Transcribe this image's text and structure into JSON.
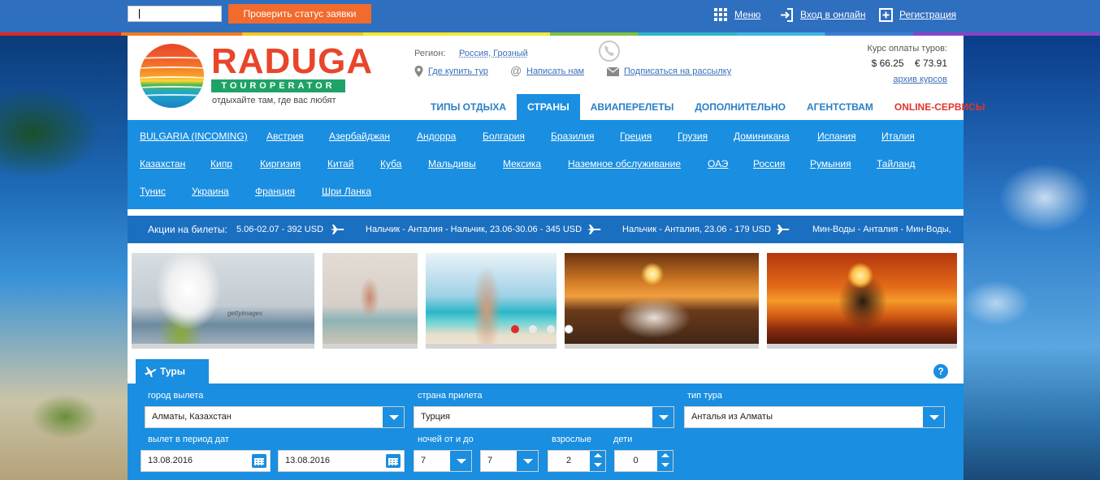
{
  "topbar": {
    "status_button": "Проверить статус заявки",
    "menu_label": "Меню",
    "login_label": "Вход в онлайн",
    "register_label": "Регистрация"
  },
  "header": {
    "logo_title": "RADUGA",
    "logo_sub": "TOUROPERATOR",
    "slogan": "отдыхайте там, где вас любят",
    "region_label": "Регион:",
    "region_value": "Россия, Грозный",
    "where_buy": "Где купить тур",
    "write_us": "Написать нам",
    "subscribe": "Подписаться на рассылку",
    "rate_label": "Курс оплаты туров:",
    "usd_rate": "$ 66.25",
    "eur_rate": "€ 73.91",
    "archive": "архив курсов"
  },
  "mainnav": {
    "items": [
      "ТИПЫ ОТДЫХА",
      "СТРАНЫ",
      "АВИАПЕРЕЛЕТЫ",
      "ДОПОЛНИТЕЛЬНО",
      "АГЕНТСТВАМ",
      "ONLINE-СЕРВИСЫ"
    ]
  },
  "countries": [
    "BULGARIA (INCOMING)",
    "Австрия",
    "Азербайджан",
    "Андорра",
    "Болгария",
    "Бразилия",
    "Греция",
    "Грузия",
    "Доминикана",
    "Испания",
    "Италия",
    "Казахстан",
    "Кипр",
    "Киргизия",
    "Китай",
    "Куба",
    "Мальдивы",
    "Мексика",
    "Наземное обслуживание",
    "ОАЭ",
    "Россия",
    "Румыния",
    "Тайланд",
    "Тунис",
    "Украина",
    "Франция",
    "Шри Ланка"
  ],
  "ticker": {
    "label": "Акции на билеты:",
    "items": [
      "5.06-02.07 - 392 USD",
      "Нальчик - Анталия - Нальчик, 23.06-30.06 - 345 USD",
      "Нальчик - Анталия, 23.06 - 179 USD",
      "Мин-Воды - Анталия - Мин-Воды,"
    ]
  },
  "tab_label": "Туры",
  "help": "?",
  "search": {
    "from_label": "город вылета",
    "from_value": "Алматы, Казахстан",
    "country_label": "страна прилета",
    "country_value": "Турция",
    "type_label": "тип тура",
    "type_value": "Анталья из Алматы",
    "period_label": "вылет в период дат",
    "date_from": "13.08.2016",
    "date_to": "13.08.2016",
    "nights_label": "ночей от и до",
    "nights_from": "7",
    "nights_to": "7",
    "adults_label": "взрослые",
    "adults_value": "2",
    "children_label": "дети",
    "children_value": "0"
  },
  "gallery_watermark": "gettyimages",
  "colors": {
    "topbar": "#2f6fc0",
    "accent": "#1a8ee0",
    "orange": "#f26a2c",
    "red_nav": "#e0352a",
    "logo_red": "#e8452a",
    "logo_green": "#1fa267"
  }
}
